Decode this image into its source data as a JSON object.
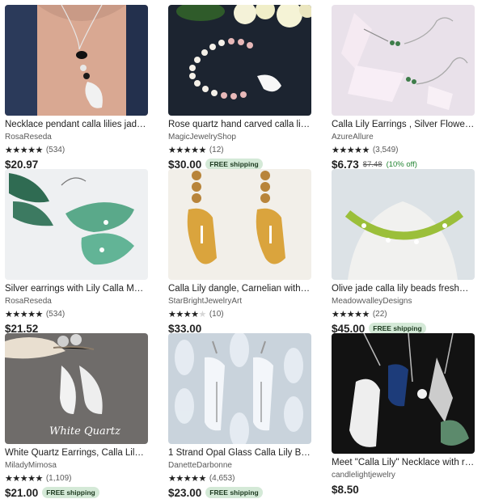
{
  "listings": [
    {
      "title": "Necklace pendant calla lilies jade p...",
      "shop": "RosaReseda",
      "rating": 5,
      "reviews": "(534)",
      "price": "$20.97",
      "original_price": "",
      "discount": "",
      "badge": ""
    },
    {
      "title": "Rose quartz hand carved calla lily fl...",
      "shop": "MagicJewelryShop",
      "rating": 5,
      "reviews": "(12)",
      "price": "$30.00",
      "original_price": "",
      "discount": "",
      "badge": "FREE shipping"
    },
    {
      "title": "Calla Lily Earrings , Silver Flower Ea...",
      "shop": "AzureAllure",
      "rating": 5,
      "reviews": "(3,549)",
      "price": "$6.73",
      "original_price": "$7.48",
      "discount": "(10% off)",
      "badge": ""
    },
    {
      "title": "Silver earrings with Lily Calla Malay...",
      "shop": "RosaReseda",
      "rating": 5,
      "reviews": "(534)",
      "price": "$21.52",
      "original_price": "",
      "discount": "",
      "badge": ""
    },
    {
      "title": "Calla Lily dangle, Carnelian with yel...",
      "shop": "StarBrightJewelryArt",
      "rating": 4,
      "reviews": "(10)",
      "price": "$33.00",
      "original_price": "",
      "discount": "",
      "badge": ""
    },
    {
      "title": "Olive jade calla lily beads freshwate...",
      "shop": "MeadowvalleyDesigns",
      "rating": 5,
      "reviews": "(22)",
      "price": "$45.00",
      "original_price": "",
      "discount": "",
      "badge": "FREE shipping"
    },
    {
      "title": "White Quartz Earrings, Calla Lily Ear...",
      "shop": "MiladyMimosa",
      "rating": 5,
      "reviews": "(1,109)",
      "price": "$21.00",
      "original_price": "",
      "discount": "",
      "badge": "FREE shipping",
      "image_caption": "White Quartz"
    },
    {
      "title": "1 Strand Opal Glass Calla Lily Beads...",
      "shop": "DanetteDarbonne",
      "rating": 5,
      "reviews": "(4,653)",
      "price": "$23.00",
      "original_price": "",
      "discount": "",
      "badge": "FREE shipping"
    },
    {
      "title": "Meet \"Calla Lily\" Necklace with real ...",
      "shop": "candlelightjewelry",
      "rating": 0,
      "reviews": "",
      "price": "$8.50",
      "original_price": "",
      "discount": "",
      "badge": ""
    }
  ],
  "star_glyphs": "★★★★★",
  "colors": {
    "badge_bg": "#d4e9d7",
    "badge_text": "#1d3a20",
    "discount": "#258635"
  }
}
